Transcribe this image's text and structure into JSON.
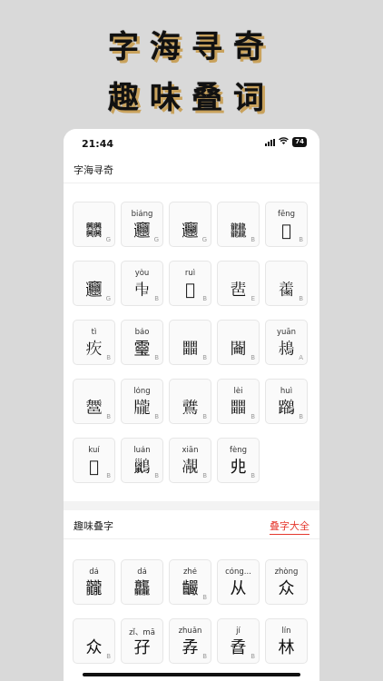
{
  "promo": {
    "line1": "字海寻奇",
    "line2": "趣味叠词"
  },
  "status_bar": {
    "time": "21:44",
    "battery": "74"
  },
  "section1": {
    "title": "字海寻奇",
    "items": [
      {
        "pinyin": "",
        "glyph": "𠔻",
        "grade": "G"
      },
      {
        "pinyin": "biáng",
        "glyph": "𰻝",
        "grade": "G"
      },
      {
        "pinyin": "",
        "glyph": "𰻞",
        "grade": "G"
      },
      {
        "pinyin": "",
        "glyph": "𪚥",
        "grade": "B"
      },
      {
        "pinyin": "fēng",
        "glyph": "𩙫",
        "grade": "B"
      },
      {
        "pinyin": "",
        "glyph": "𰻝",
        "grade": "G"
      },
      {
        "pinyin": "yòu",
        "glyph": "𠁩",
        "grade": "B"
      },
      {
        "pinyin": "ruì",
        "glyph": "𧇸",
        "grade": "B"
      },
      {
        "pinyin": "",
        "glyph": "𩇯",
        "grade": "E"
      },
      {
        "pinyin": "",
        "glyph": "𪉤",
        "grade": "B"
      },
      {
        "pinyin": "tì",
        "glyph": "𤴼",
        "grade": "B"
      },
      {
        "pinyin": "báo",
        "glyph": "𩆜",
        "grade": "B"
      },
      {
        "pinyin": "",
        "glyph": "𤳳",
        "grade": "B"
      },
      {
        "pinyin": "",
        "glyph": "𨷲",
        "grade": "B"
      },
      {
        "pinyin": "yuān",
        "glyph": "𪀖",
        "grade": "A"
      },
      {
        "pinyin": "",
        "glyph": "𨝬",
        "grade": "B"
      },
      {
        "pinyin": "lóng",
        "glyph": "𪚖",
        "grade": "B"
      },
      {
        "pinyin": "",
        "glyph": "𪇻",
        "grade": "B"
      },
      {
        "pinyin": "lèi",
        "glyph": "𤳳",
        "grade": "B"
      },
      {
        "pinyin": "huì",
        "glyph": "𪆽",
        "grade": "B"
      },
      {
        "pinyin": "kuí",
        "glyph": "𣛧",
        "grade": "B"
      },
      {
        "pinyin": "luán",
        "glyph": "𪇹",
        "grade": "B"
      },
      {
        "pinyin": "xiān",
        "glyph": "𩇟",
        "grade": "B"
      },
      {
        "pinyin": "fèng",
        "glyph": "𠑹",
        "grade": "B"
      }
    ]
  },
  "section2": {
    "title": "趣味叠字",
    "link": "叠字大全",
    "items": [
      {
        "pinyin": "dá",
        "glyph": "龖",
        "grade": ""
      },
      {
        "pinyin": "dá",
        "glyph": "龘",
        "grade": ""
      },
      {
        "pinyin": "zhé",
        "glyph": "䶫",
        "grade": "B"
      },
      {
        "pinyin": "cóng...",
        "glyph": "从",
        "grade": ""
      },
      {
        "pinyin": "zhòng",
        "glyph": "众",
        "grade": ""
      },
      {
        "pinyin": "",
        "glyph": "众",
        "grade": "B"
      },
      {
        "pinyin": "zǐ、mā",
        "glyph": "孖",
        "grade": ""
      },
      {
        "pinyin": "zhuǎn",
        "glyph": "孨",
        "grade": "B"
      },
      {
        "pinyin": "jí",
        "glyph": "孴",
        "grade": "B"
      },
      {
        "pinyin": "lín",
        "glyph": "林",
        "grade": ""
      }
    ]
  },
  "colors": {
    "accent": "#e5382e",
    "background": "#d9d9d9",
    "card": "#fafafa"
  },
  "icons": [
    "signal-icon",
    "wifi-icon",
    "battery-icon"
  ]
}
